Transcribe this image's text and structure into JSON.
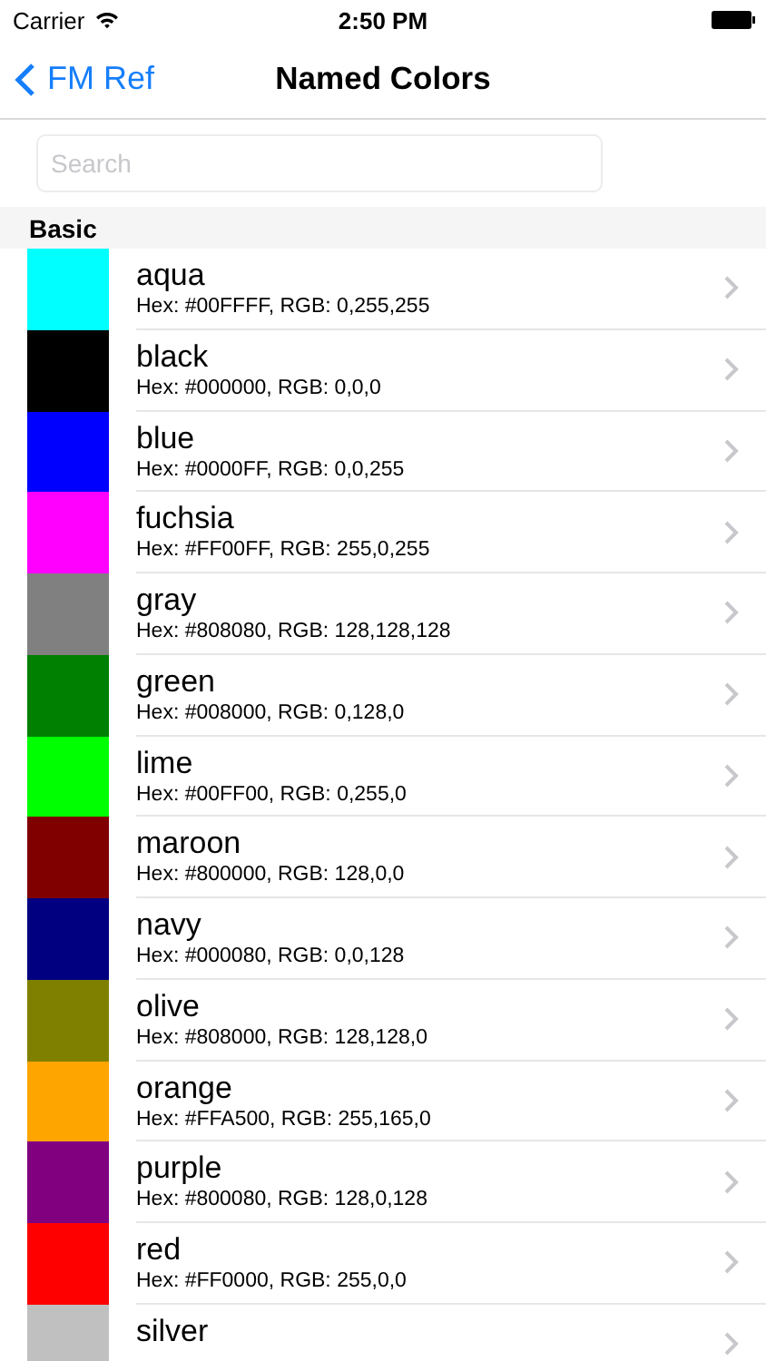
{
  "status_bar": {
    "carrier": "Carrier",
    "time": "2:50 PM"
  },
  "nav_bar": {
    "back": "FM Ref",
    "title": "Named Colors"
  },
  "search": {
    "placeholder": "Search"
  },
  "section": {
    "title": "Basic"
  },
  "colors": [
    {
      "name": "aqua",
      "detail": "Hex: #00FFFF, RGB: 0,255,255",
      "color": "#00ffff"
    },
    {
      "name": "black",
      "detail": "Hex: #000000, RGB: 0,0,0",
      "color": "#000000"
    },
    {
      "name": "blue",
      "detail": "Hex: #0000FF, RGB: 0,0,255",
      "color": "#0000ff"
    },
    {
      "name": "fuchsia",
      "detail": "Hex: #FF00FF, RGB: 255,0,255",
      "color": "#ff00ff"
    },
    {
      "name": "gray",
      "detail": "Hex: #808080, RGB: 128,128,128",
      "color": "#808080"
    },
    {
      "name": "green",
      "detail": "Hex: #008000, RGB: 0,128,0",
      "color": "#008000"
    },
    {
      "name": "lime",
      "detail": "Hex: #00FF00, RGB: 0,255,0",
      "color": "#00ff00"
    },
    {
      "name": "maroon",
      "detail": "Hex: #800000, RGB: 128,0,0",
      "color": "#800000"
    },
    {
      "name": "navy",
      "detail": "Hex: #000080, RGB: 0,0,128",
      "color": "#000080"
    },
    {
      "name": "olive",
      "detail": "Hex: #808000, RGB: 128,128,0",
      "color": "#808000"
    },
    {
      "name": "orange",
      "detail": "Hex: #FFA500, RGB: 255,165,0",
      "color": "#ffa500"
    },
    {
      "name": "purple",
      "detail": "Hex: #800080, RGB: 128,0,128",
      "color": "#800080"
    },
    {
      "name": "red",
      "detail": "Hex: #FF0000, RGB: 255,0,0",
      "color": "#ff0000"
    },
    {
      "name": "silver",
      "color": "#c0c0c0"
    }
  ]
}
